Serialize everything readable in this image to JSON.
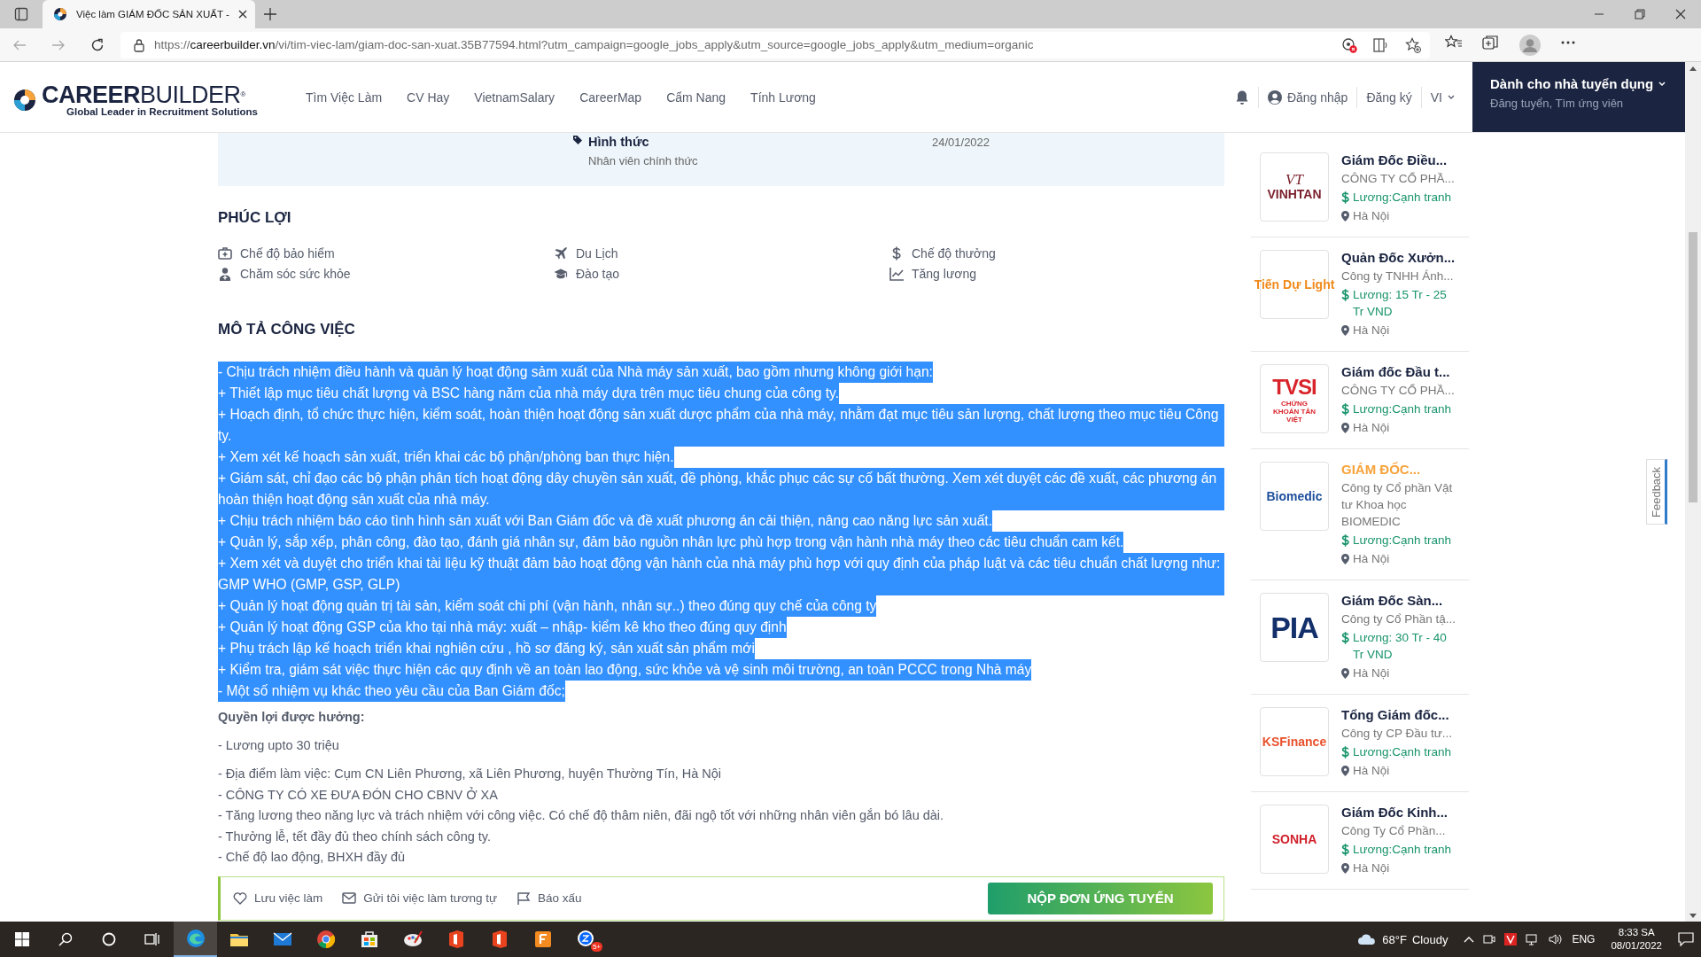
{
  "browser": {
    "tab": {
      "title": "Việc làm GIÁM ĐỐC SẢN XUẤT -"
    },
    "url": "https://**careerbuilder.vn**/vi/tim-viec-lam/giam-doc-san-xuat.35B77594.html?utm_campaign=google_jobs_apply&utm_source=google_jobs_apply&utm_medium=organic"
  },
  "header": {
    "logo": {
      "name": "**CAREER**BUILDER$^{®}$",
      "tagline": "Global Leader in Recruitment Solutions"
    },
    "nav": [
      "Tìm Việc Làm",
      "CV Hay",
      "VietnamSalary",
      "CareerMap",
      "Cẩm Nang",
      "Tính Lương"
    ],
    "login": "Đăng nhập",
    "register": "Đăng ký",
    "language": "VI",
    "employer": {
      "title": "Dành cho nhà tuyển dụng",
      "subtitle": "Đăng tuyển, Tìm ứng viên"
    }
  },
  "job_info": {
    "label": "Hình thức",
    "value": "Nhân viên chính thức",
    "date": "24/01/2022"
  },
  "benefits": {
    "title": "PHÚC LỢI",
    "items": [
      {
        "kind": "insurance",
        "label": "Chế độ bảo hiểm"
      },
      {
        "kind": "travel",
        "label": "Du Lịch"
      },
      {
        "kind": "bonus",
        "label": "Chế độ thưởng"
      },
      {
        "kind": "health",
        "label": "Chăm sóc sức khỏe"
      },
      {
        "kind": "training",
        "label": "Đào tạo"
      },
      {
        "kind": "raise",
        "label": "Tăng lương"
      }
    ]
  },
  "description": {
    "title": "MÔ TẢ CÔNG VIỆC",
    "lines": [
      {
        "text": "- Chịu trách nhiệm điều hành và quản lý hoạt động sảm xuất của Nhà máy sản xuất, bao gồm nhưng không giới hạn:",
        "selected": true
      },
      {
        "text": "+ Thiết lập mục tiêu chất lượng và BSC hàng năm của nhà máy dựa trên mục tiêu chung của công ty.",
        "selected": true
      },
      {
        "text": "+ Hoạch định, tổ chức thực hiện, kiểm soát, hoàn thiện hoạt động sản xuất dược phẩm của nhà máy, nhằm đạt mục tiêu sản lượng, chất lượng theo mục tiêu Công ty.",
        "selected": true
      },
      {
        "text": "+ Xem xét kế hoạch sản xuất, triển khai các bộ phận/phòng ban thực hiện.",
        "selected": true
      },
      {
        "text": "+ Giám sát, chỉ đạo các bộ phận phân tích hoạt động dây chuyền sản xuất, đề phòng, khắc phục các sự cố bất thường. Xem xét duyệt các đề xuất, các phương án hoàn thiện hoạt động sản xuất của nhà máy.",
        "selected": true
      },
      {
        "text": "+ Chịu trách nhiệm báo cáo tình hình sản xuất với Ban Giám đốc và đề xuất phương án cải thiện, nâng cao năng lực sản xuất.",
        "selected": true
      },
      {
        "text": "+ Quản lý, sắp xếp, phân công, đào tạo, đánh giá nhân sự, đảm bảo nguồn nhân lực phù hợp trong vận hành nhà máy theo các tiêu chuẩn cam kết.",
        "selected": true
      },
      {
        "text": "+ Xem xét và duyệt cho triển khai tài liệu kỹ thuật đảm bảo hoạt động vận hành của nhà máy phù hợp với quy định của pháp luật và các tiêu chuẩn chất lượng như: GMP WHO (GMP, GSP, GLP)",
        "selected": true
      },
      {
        "text": "+ Quản lý hoạt động quản trị tài sản, kiểm soát chi phí (vận hành, nhân sự..) theo đúng quy chế của công ty",
        "selected": true
      },
      {
        "text": "+ Quản lý hoạt động GSP của kho tại nhà máy: xuất – nhập- kiểm kê kho theo đúng quy định",
        "selected": true
      },
      {
        "text": "+ Phụ trách lập kế hoạch triển khai nghiên cứu , hồ sơ đăng ký, sản xuất sản phẩm mới",
        "selected": true
      },
      {
        "text": "+ Kiểm tra, giám sát việc thực hiện các quy định về an toàn lao động, sức khỏe và vệ sinh môi trường, an toàn PCCC trong Nhà máy",
        "selected": true
      },
      {
        "text": "- Một số nhiệm vụ khác theo yêu cầu của Ban Giám đốc;",
        "selected": true
      }
    ]
  },
  "perks": {
    "title": "Quyền lợi được hưởng:",
    "groups": [
      [
        "- Lương upto 30 triệu"
      ],
      [
        "- Địa điểm làm việc: Cụm CN Liên Phương, xã Liên Phương, huyện Thường Tín, Hà Nội",
        "- CÔNG TY CÓ XE ĐƯA ĐÓN CHO CBNV Ở XA",
        "- Tăng lương theo năng lực và trách nhiệm với công việc. Có chế độ thâm niên, đãi ngộ tốt với những nhân viên gắn bó lâu dài.",
        "- Thưởng lễ, tết đầy đủ theo chính sách công ty.",
        "- Chế độ lao động, BHXH đầy đủ"
      ]
    ]
  },
  "actions": {
    "save": "Lưu việc làm",
    "similar": "Gửi tôi việc làm tương tự",
    "report": "Báo xấu",
    "apply": "NỘP ĐƠN ỨNG TUYỂN"
  },
  "jobs": [
    {
      "logo": {
        "mark": "VT",
        "text": "VINHTAN",
        "color": "#7a1f2b"
      },
      "title": "Giám Đốc Điều...",
      "featured": false,
      "company": "CÔNG TY CỔ PHẦ...",
      "salary": "Lương:Cạnh tranh",
      "location": "Hà Nội"
    },
    {
      "logo": {
        "text": "Tiến Dự Light",
        "color": "#f08a1c"
      },
      "title": "Quản Đốc Xưởn...",
      "featured": false,
      "company": "Công ty TNHH Ánh...",
      "salary": "Lương: 15 Tr - 25 Tr VND",
      "location": "Hà Nội"
    },
    {
      "logo": {
        "text": "TVSI",
        "sub": "CHỨNG KHOÁN TÂN VIỆT",
        "color": "#d8232a"
      },
      "title": "Giám đốc Đầu t...",
      "featured": false,
      "company": "CÔNG TY CỔ PHẦ...",
      "salary": "Lương:Cạnh tranh",
      "location": "Hà Nội"
    },
    {
      "logo": {
        "text": "Biomedic",
        "color": "#1d4f9c"
      },
      "title": "GIÁM ĐỐC...",
      "featured": true,
      "company": "Công ty Cổ phần Vật tư Khoa học BIOMEDIC",
      "salary": "Lương:Cạnh tranh",
      "location": "Hà Nội"
    },
    {
      "logo": {
        "text": "PIA",
        "color": "#13306b"
      },
      "title": "Giám Đốc Sàn...",
      "featured": false,
      "company": "Công ty Cổ Phần tậ...",
      "salary": "Lương: 30 Tr - 40 Tr VND",
      "location": "Hà Nội"
    },
    {
      "logo": {
        "text": "KSFinance",
        "color": "#e9512c"
      },
      "title": "Tổng Giám đốc...",
      "featured": false,
      "company": "Công ty CP Đầu tư...",
      "salary": "Lương:Cạnh tranh",
      "location": "Hà Nội"
    },
    {
      "logo": {
        "text": "SONHA",
        "color": "#d0202b"
      },
      "title": "Giám Đốc Kinh...",
      "featured": false,
      "company": "Công Ty Cổ Phần...",
      "salary": "Lương:Cạnh tranh",
      "location": "Hà Nội"
    }
  ],
  "feedback": "Feedback",
  "taskbar": {
    "apps": [
      {
        "kind": "edge",
        "active": true
      },
      {
        "kind": "explorer",
        "active": false
      },
      {
        "kind": "mail",
        "active": false
      },
      {
        "kind": "chrome",
        "active": false
      },
      {
        "kind": "store",
        "active": false
      },
      {
        "kind": "paint",
        "active": false
      },
      {
        "kind": "office",
        "active": false
      },
      {
        "kind": "office",
        "active": false
      },
      {
        "kind": "pdf",
        "active": false
      },
      {
        "kind": "chat",
        "active": false,
        "badge": "5+"
      }
    ],
    "weather": {
      "temp": "68°F",
      "condition": "Cloudy"
    },
    "language": "ENG",
    "time": "8:33 SA",
    "date": "08/01/2022"
  }
}
